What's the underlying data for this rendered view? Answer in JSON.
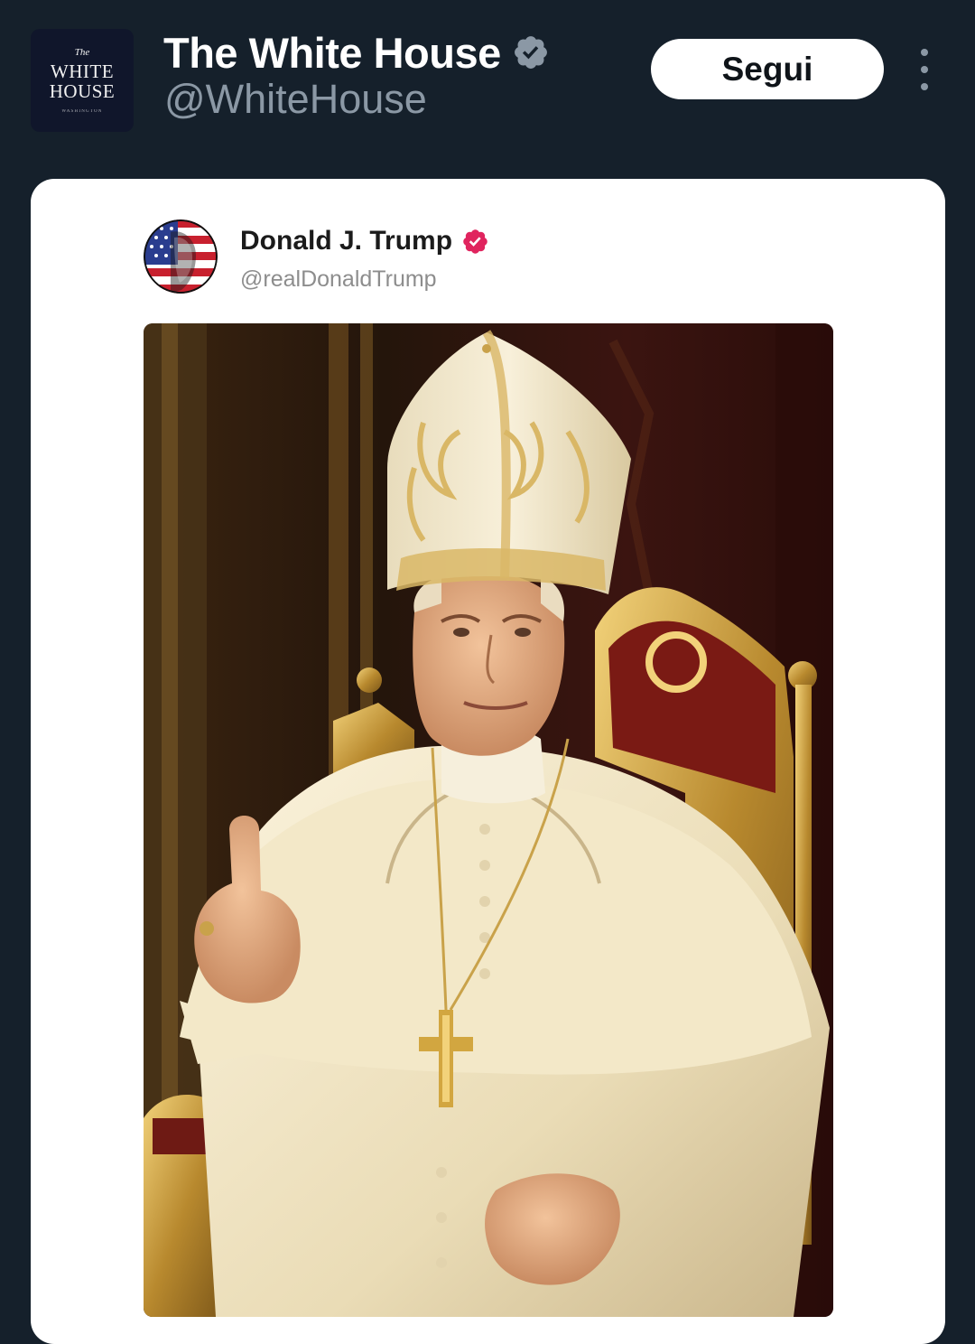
{
  "post": {
    "author_name": "The White House",
    "author_handle": "@WhiteHouse",
    "follow_label": "Segui",
    "logo": {
      "line1": "The",
      "line2": "WHITE",
      "line3": "HOUSE",
      "subline": "WASHINGTON"
    }
  },
  "quoted": {
    "author_name": "Donald J. Trump",
    "author_handle": "@realDonaldTrump",
    "badge_color": "#e0245e"
  },
  "icons": {
    "verified": "verified-badge-icon",
    "more": "more-vertical-icon"
  },
  "colors": {
    "background": "#15202b",
    "verified_badge": "#8b98a5",
    "follow_button": "#ffffff"
  }
}
